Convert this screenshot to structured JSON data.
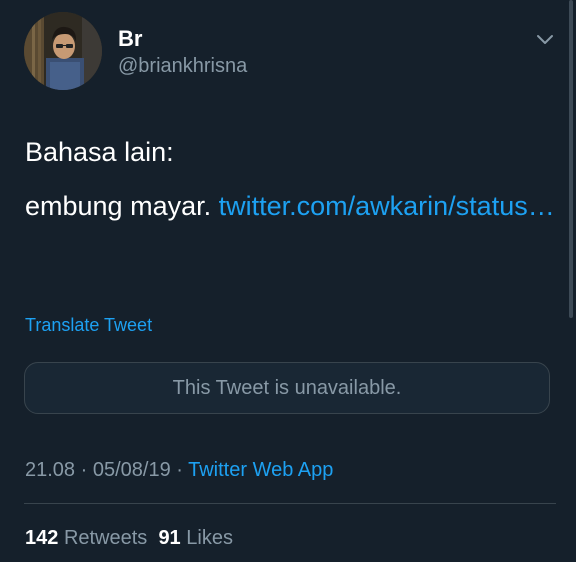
{
  "author": {
    "display_name": "Br",
    "handle": "@briankhrisna",
    "avatar_icon": "profile-photo"
  },
  "tweet": {
    "line1": "Bahasa lain:",
    "line2_text": "embung mayar. ",
    "line2_link": "twitter.com/awkarin/status…",
    "translate_label": "Translate Tweet"
  },
  "quoted": {
    "message": "This Tweet is unavailable."
  },
  "meta": {
    "time": "21.08",
    "separator1": " · ",
    "date": "05/08/19",
    "separator2": " · ",
    "source": "Twitter Web App"
  },
  "stats": {
    "retweets_count": "142",
    "retweets_label": "Retweets",
    "likes_count": "91",
    "likes_label": "Likes"
  },
  "colors": {
    "background": "#15202b",
    "accent": "#1da1f2",
    "muted": "#8899a6",
    "border": "#38444d"
  }
}
